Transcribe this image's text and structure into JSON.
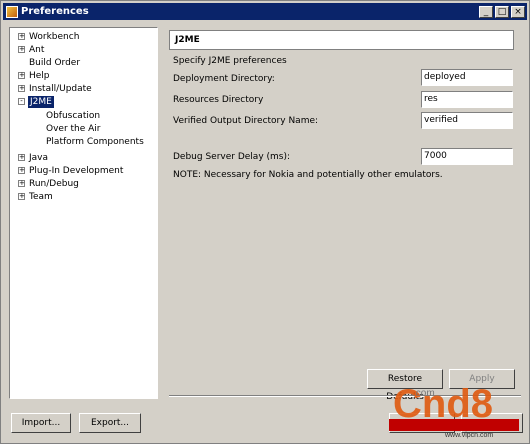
{
  "window": {
    "title": "Preferences"
  },
  "tree": {
    "items": [
      {
        "label": "Workbench",
        "expander": "+"
      },
      {
        "label": "Ant",
        "expander": "+"
      },
      {
        "label": "Build Order",
        "expander": ""
      },
      {
        "label": "Help",
        "expander": "+"
      },
      {
        "label": "Install/Update",
        "expander": "+"
      },
      {
        "label": "J2ME",
        "expander": "-"
      },
      {
        "label": "Obfuscation",
        "expander": ""
      },
      {
        "label": "Over the Air",
        "expander": ""
      },
      {
        "label": "Platform Components",
        "expander": ""
      },
      {
        "label": "Java",
        "expander": "+"
      },
      {
        "label": "Plug-In Development",
        "expander": "+"
      },
      {
        "label": "Run/Debug",
        "expander": "+"
      },
      {
        "label": "Team",
        "expander": "+"
      }
    ]
  },
  "panel": {
    "header": "J2ME",
    "description": "Specify J2ME preferences",
    "deploy_label": "Deployment Directory:",
    "deploy_value": "deployed",
    "res_label": "Resources Directory",
    "res_value": "res",
    "verified_label": "Verified Output Directory Name:",
    "verified_value": "verified",
    "debug_label": "Debug Server Delay (ms):",
    "debug_value": "7000",
    "note": "NOTE: Necessary for Nokia and potentially other emulators."
  },
  "buttons": {
    "restore": "Restore Defaults",
    "apply": "Apply",
    "import": "Import...",
    "export": "Export..."
  },
  "watermark": {
    "brand": "Cnd8",
    "domain": ".com",
    "url": "www.vipcn.com"
  }
}
